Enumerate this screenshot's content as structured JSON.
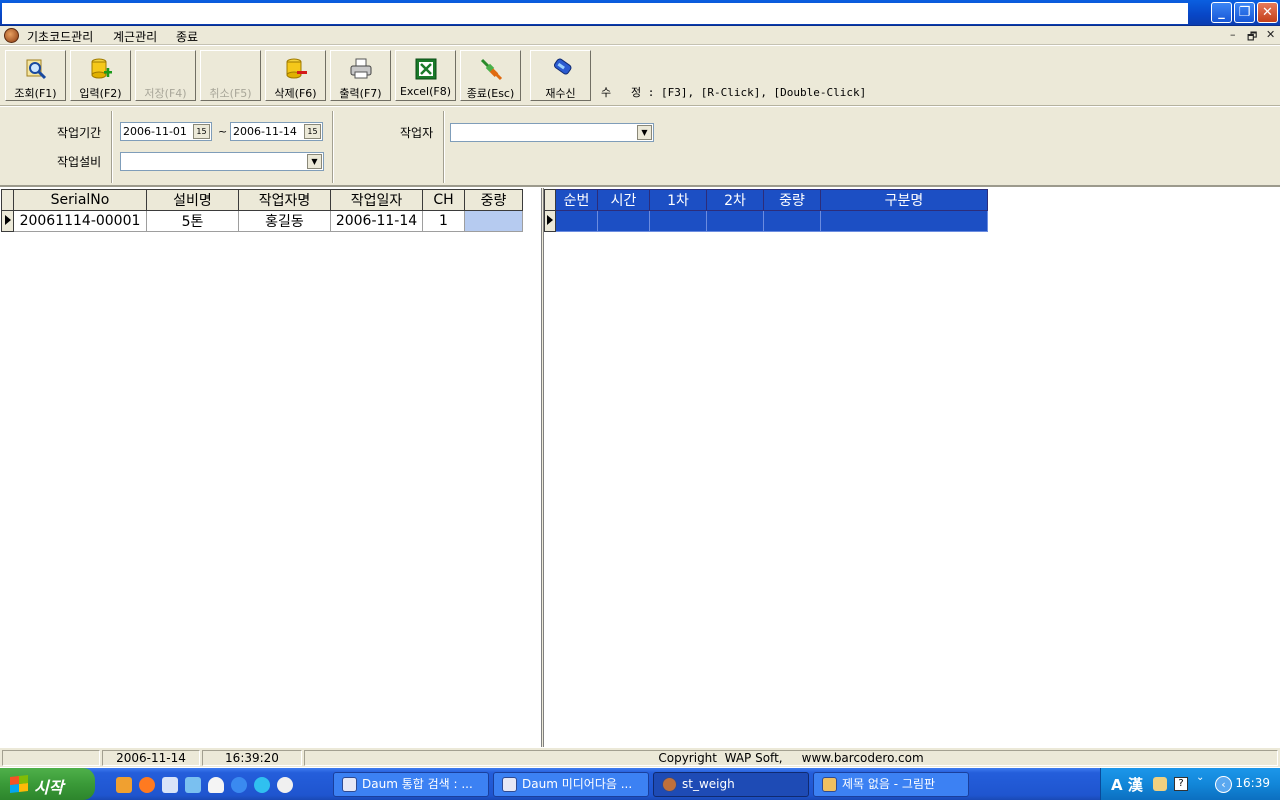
{
  "menu": {
    "items": [
      "기초코드관리",
      "계근관리",
      "종료"
    ]
  },
  "toolbar": {
    "buttons": [
      {
        "label": "조회(F1)",
        "enabled": true,
        "icon": "magnifier-icon"
      },
      {
        "label": "입력(F2)",
        "enabled": true,
        "icon": "database-add-icon"
      },
      {
        "label": "저장(F4)",
        "enabled": false,
        "icon": "save-icon"
      },
      {
        "label": "취소(F5)",
        "enabled": false,
        "icon": "cancel-icon"
      },
      {
        "label": "삭제(F6)",
        "enabled": true,
        "icon": "database-delete-icon"
      },
      {
        "label": "출력(F7)",
        "enabled": true,
        "icon": "printer-icon"
      },
      {
        "label": "Excel(F8)",
        "enabled": true,
        "icon": "excel-icon"
      },
      {
        "label": "종료(Esc)",
        "enabled": true,
        "icon": "plug-exit-icon"
      },
      {
        "label": "재수신",
        "enabled": true,
        "icon": "phone-receive-icon"
      }
    ],
    "hint": "수   정 : [F3], [R-Click], [Double-Click]"
  },
  "filter": {
    "period_label": "작업기간",
    "date_from": "2006-11-01",
    "date_sep": "~",
    "date_to": "2006-11-14",
    "calendar_glyph": "15",
    "equipment_label": "작업설비",
    "equipment_value": "",
    "worker_label": "작업자",
    "worker_value": ""
  },
  "left_grid": {
    "columns": [
      "SerialNo",
      "설비명",
      "작업자명",
      "작업일자",
      "CH",
      "중량"
    ],
    "rows": [
      [
        "20061114-00001",
        "5톤",
        "홍길동",
        "2006-11-14",
        "1",
        ""
      ]
    ]
  },
  "right_grid": {
    "columns": [
      "순번",
      "시간",
      "1차",
      "2차",
      "중량",
      "구분명"
    ],
    "rows": [
      [
        "",
        "",
        "",
        "",
        "",
        ""
      ]
    ]
  },
  "statusbar": {
    "date": "2006-11-14",
    "time": "16:39:20",
    "copyright": "Copyright  WAP Soft,     www.barcodero.com"
  },
  "taskbar": {
    "start_label": "시작",
    "tasks": [
      {
        "label": "Daum 통합 검색 : ...",
        "active": false
      },
      {
        "label": "Daum 미디어다음 ...",
        "active": false
      },
      {
        "label": "st_weigh",
        "active": true
      },
      {
        "label": "제목 없음 - 그림판",
        "active": false
      }
    ],
    "ime": "A 漢",
    "clock": "16:39"
  },
  "colors": {
    "face": "#ece9d8",
    "selection_blue": "#1c4fc4",
    "selected_cell": "#b6cbf0",
    "taskbar_blue": "#245edb",
    "start_green": "#3a9a38"
  }
}
